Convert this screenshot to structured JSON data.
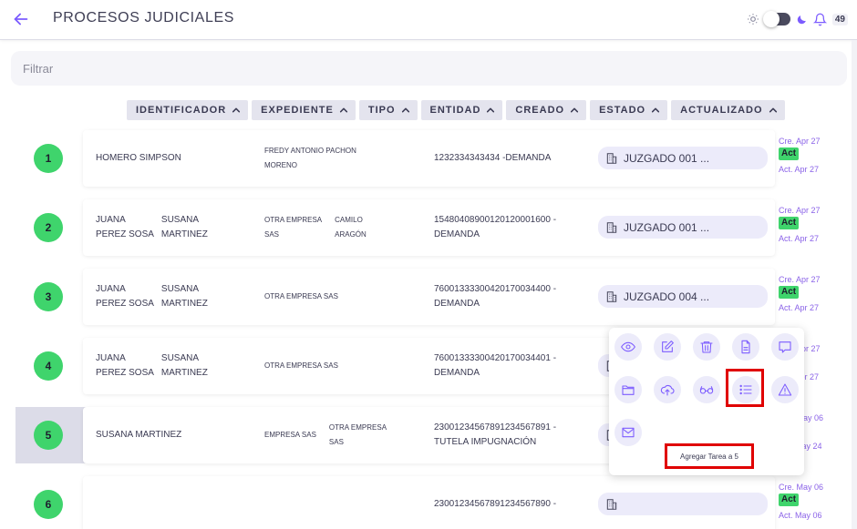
{
  "header": {
    "title": "PROCESOS JUDICIALES",
    "notifications": "49"
  },
  "filter": {
    "placeholder": "Filtrar"
  },
  "sort_columns": [
    "IDENTIFICADOR",
    "EXPEDIENTE",
    "TIPO",
    "ENTIDAD",
    "CREADO",
    "ESTADO",
    "ACTUALIZADO"
  ],
  "rows": [
    {
      "num": "1",
      "names": [
        [
          "HOMERO SIMPSON"
        ]
      ],
      "exp": [
        [
          "FREDY ANTONIO PACHON",
          "MORENO"
        ]
      ],
      "id": [
        "1232334343434 -DEMANDA"
      ],
      "court": "JUZGADO 001 ...",
      "created": "Cre. Apr 27",
      "state": "Act",
      "updated": "Act. Apr 27"
    },
    {
      "num": "2",
      "names": [
        [
          "JUANA",
          "PEREZ SOSA"
        ],
        [
          "SUSANA",
          "MARTINEZ"
        ]
      ],
      "exp": [
        [
          "OTRA EMPRESA",
          "SAS"
        ],
        [
          "CAMILO",
          "ARAGÓN"
        ]
      ],
      "id": [
        "15480408900120120001600 -",
        "DEMANDA"
      ],
      "court": "JUZGADO 001 ...",
      "created": "Cre. Apr 27",
      "state": "Act",
      "updated": "Act. Apr 27"
    },
    {
      "num": "3",
      "names": [
        [
          "JUANA",
          "PEREZ SOSA"
        ],
        [
          "SUSANA",
          "MARTINEZ"
        ]
      ],
      "exp": [
        [
          "OTRA EMPRESA SAS"
        ]
      ],
      "id": [
        "76001333300420170034400 -",
        "DEMANDA"
      ],
      "court": "JUZGADO 004 ...",
      "created": "Cre. Apr 27",
      "state": "Act",
      "updated": "Act. Apr 27"
    },
    {
      "num": "4",
      "names": [
        [
          "JUANA",
          "PEREZ SOSA"
        ],
        [
          "SUSANA",
          "MARTINEZ"
        ]
      ],
      "exp": [
        [
          "OTRA EMPRESA SAS"
        ]
      ],
      "id": [
        "76001333300420170034401 -",
        "DEMANDA"
      ],
      "court": "",
      "created": "Cre. Apr 27",
      "state": "Act",
      "updated": "Act. Apr 27"
    },
    {
      "num": "5",
      "names": [
        [
          "SUSANA MARTINEZ"
        ]
      ],
      "exp": [
        [
          "EMPRESA SAS"
        ],
        [
          "OTRA EMPRESA",
          "SAS"
        ]
      ],
      "id": [
        "23001234567891234567891 -",
        "TUTELA IMPUGNACIÓN"
      ],
      "court": "",
      "created": "Cre. May 06",
      "state": "Act",
      "updated": "Act. May 24"
    },
    {
      "num": "6",
      "names": [],
      "exp": [],
      "id": [
        "23001234567891234567890 -"
      ],
      "court": "",
      "created": "Cre. May 06",
      "state": "Act",
      "updated": "Act. May 06"
    }
  ],
  "popup": {
    "actions": [
      "eye-icon",
      "edit-icon",
      "trash-icon",
      "document-icon",
      "comment-icon",
      "folder-icon",
      "cloud-upload-icon",
      "glasses-icon",
      "list-icon",
      "warning-icon",
      "mail-icon"
    ],
    "tooltip": "Agregar Tarea a 5"
  },
  "colors": {
    "accent": "#7c5cff",
    "green": "#3fd46c",
    "highlight": "#e00000"
  }
}
